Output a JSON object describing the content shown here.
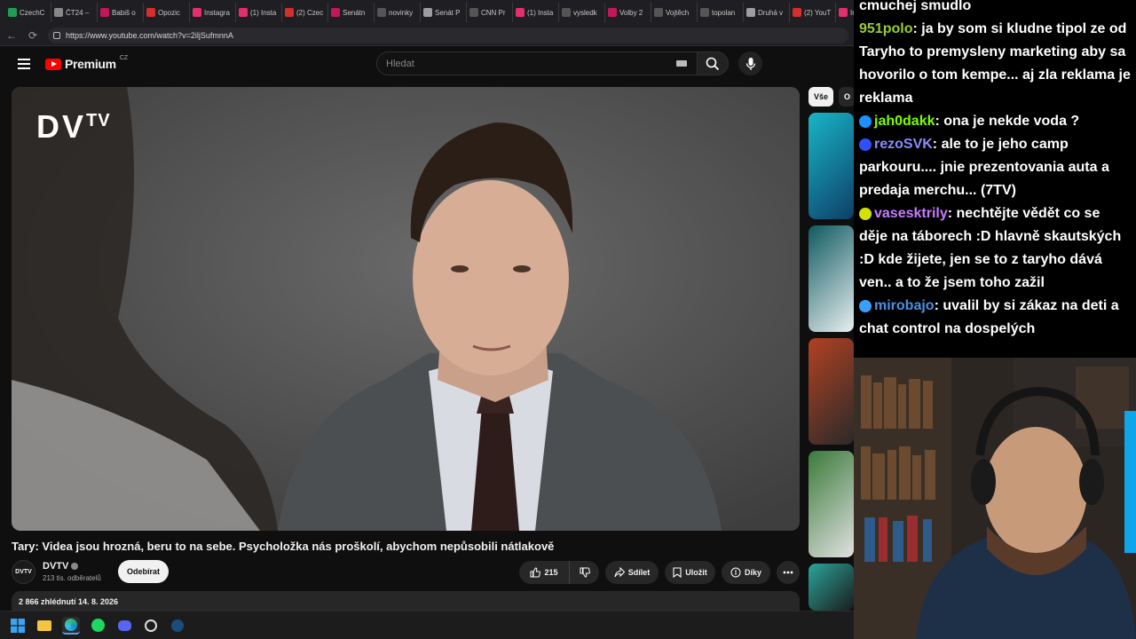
{
  "browser": {
    "tabs": [
      {
        "label": "CzechC",
        "color": "#1f9d55"
      },
      {
        "label": "ČT24 –",
        "color": "#888888"
      },
      {
        "label": "Babiš o",
        "color": "#c2185b"
      },
      {
        "label": "Opozic",
        "color": "#d32f2f"
      },
      {
        "label": "Instagra",
        "color": "#e1306c"
      },
      {
        "label": "(1) Insta",
        "color": "#e1306c"
      },
      {
        "label": "(2) Czec",
        "color": "#d32f2f"
      },
      {
        "label": "Senátn",
        "color": "#c2185b"
      },
      {
        "label": "novinky",
        "color": "#555555"
      },
      {
        "label": "Senát P",
        "color": "#9e9e9e"
      },
      {
        "label": "CNN Pr",
        "color": "#555555"
      },
      {
        "label": "(1) Insta",
        "color": "#e1306c"
      },
      {
        "label": "vysledk",
        "color": "#555555"
      },
      {
        "label": "Volby 2",
        "color": "#c2185b"
      },
      {
        "label": "Vojtěch",
        "color": "#555555"
      },
      {
        "label": "topolan",
        "color": "#555555"
      },
      {
        "label": "Druhá v",
        "color": "#9e9e9e"
      },
      {
        "label": "(2) YouT",
        "color": "#d32f2f"
      },
      {
        "label": "Instagra",
        "color": "#e1306c"
      }
    ],
    "url": "https://www.youtube.com/watch?v=2iljSufmnnA"
  },
  "youtube": {
    "logo_text": "Premium",
    "country": "CZ",
    "search_placeholder": "Hledat",
    "player_brand": "DV",
    "player_brand_sup": "TV",
    "video_title": "Tary: Videa jsou hrozná, beru to na sebe. Psycholožka nás proškolí, abychom nepůsobili nátlakově",
    "channel_avatar": "DVTV",
    "channel_name": "DVTV",
    "channel_subs": "213 tis. odběratelů",
    "subscribe": "Odebírat",
    "likes": "215",
    "share": "Sdílet",
    "save": "Uložit",
    "thanks": "Díky",
    "views_date": "2 866 zhlédnutí  14. 8. 2026",
    "chips": [
      "Vše",
      "O"
    ]
  },
  "chat": {
    "messages": [
      {
        "user": "",
        "text": "cmuchej smudlo",
        "user_color": "#ffffff",
        "badge_color": ""
      },
      {
        "user": "951polo",
        "text": ": ja by som si kludne tipol ze od Taryho to premysleny marketing aby sa hovorilo o tom kempe... aj zla reklama je reklama",
        "user_color": "#9acd32",
        "badge_color": ""
      },
      {
        "user": "jah0dakk",
        "text": ":  ona je nekde voda ?",
        "user_color": "#7cfc00",
        "badge_color": "#1e90ff"
      },
      {
        "user": "rezoSVK",
        "text": ": ale to je jeho camp parkouru.... jnie prezentovania auta a predaja merchu... (7TV)",
        "user_color": "#8a8aff",
        "badge_color": "#3050ff"
      },
      {
        "user": "vasesktrily",
        "text": ": nechtějte vědět co se děje na táborech :D hlavně skautských :D kde žijete, jen se to z taryho dává ven.. a to že jsem toho zažil",
        "user_color": "#c77dff",
        "badge_color": "#d4e000"
      },
      {
        "user": "mirobajo",
        "text": ": uvalil by si zákaz na deti a chat control na dospelých",
        "user_color": "#4a90e2",
        "badge_color": "#3aa0ff"
      }
    ]
  }
}
